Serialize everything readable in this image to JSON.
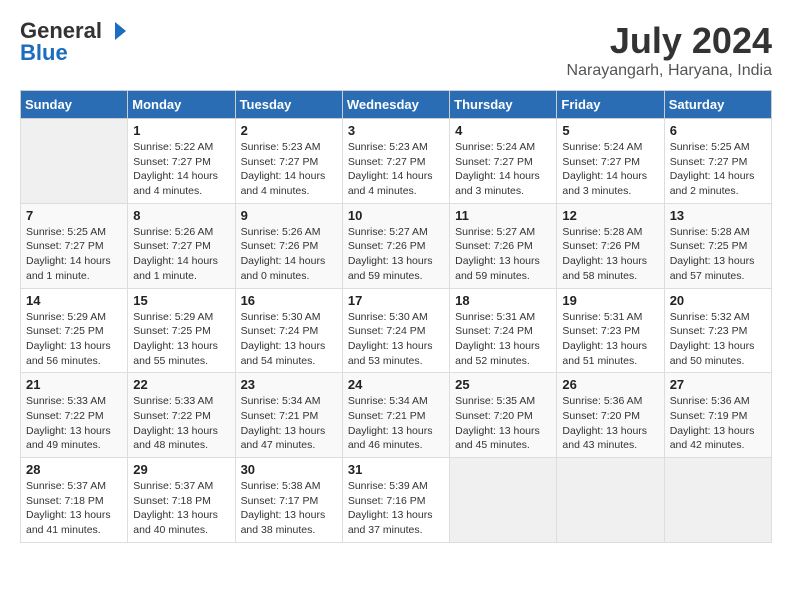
{
  "header": {
    "logo_general": "General",
    "logo_blue": "Blue",
    "month_year": "July 2024",
    "location": "Narayangarh, Haryana, India"
  },
  "calendar": {
    "days_of_week": [
      "Sunday",
      "Monday",
      "Tuesday",
      "Wednesday",
      "Thursday",
      "Friday",
      "Saturday"
    ],
    "weeks": [
      [
        {
          "day": "",
          "sunrise": "",
          "sunset": "",
          "daylight": ""
        },
        {
          "day": "1",
          "sunrise": "Sunrise: 5:22 AM",
          "sunset": "Sunset: 7:27 PM",
          "daylight": "Daylight: 14 hours and 4 minutes."
        },
        {
          "day": "2",
          "sunrise": "Sunrise: 5:23 AM",
          "sunset": "Sunset: 7:27 PM",
          "daylight": "Daylight: 14 hours and 4 minutes."
        },
        {
          "day": "3",
          "sunrise": "Sunrise: 5:23 AM",
          "sunset": "Sunset: 7:27 PM",
          "daylight": "Daylight: 14 hours and 4 minutes."
        },
        {
          "day": "4",
          "sunrise": "Sunrise: 5:24 AM",
          "sunset": "Sunset: 7:27 PM",
          "daylight": "Daylight: 14 hours and 3 minutes."
        },
        {
          "day": "5",
          "sunrise": "Sunrise: 5:24 AM",
          "sunset": "Sunset: 7:27 PM",
          "daylight": "Daylight: 14 hours and 3 minutes."
        },
        {
          "day": "6",
          "sunrise": "Sunrise: 5:25 AM",
          "sunset": "Sunset: 7:27 PM",
          "daylight": "Daylight: 14 hours and 2 minutes."
        }
      ],
      [
        {
          "day": "7",
          "sunrise": "Sunrise: 5:25 AM",
          "sunset": "Sunset: 7:27 PM",
          "daylight": "Daylight: 14 hours and 1 minute."
        },
        {
          "day": "8",
          "sunrise": "Sunrise: 5:26 AM",
          "sunset": "Sunset: 7:27 PM",
          "daylight": "Daylight: 14 hours and 1 minute."
        },
        {
          "day": "9",
          "sunrise": "Sunrise: 5:26 AM",
          "sunset": "Sunset: 7:26 PM",
          "daylight": "Daylight: 14 hours and 0 minutes."
        },
        {
          "day": "10",
          "sunrise": "Sunrise: 5:27 AM",
          "sunset": "Sunset: 7:26 PM",
          "daylight": "Daylight: 13 hours and 59 minutes."
        },
        {
          "day": "11",
          "sunrise": "Sunrise: 5:27 AM",
          "sunset": "Sunset: 7:26 PM",
          "daylight": "Daylight: 13 hours and 59 minutes."
        },
        {
          "day": "12",
          "sunrise": "Sunrise: 5:28 AM",
          "sunset": "Sunset: 7:26 PM",
          "daylight": "Daylight: 13 hours and 58 minutes."
        },
        {
          "day": "13",
          "sunrise": "Sunrise: 5:28 AM",
          "sunset": "Sunset: 7:25 PM",
          "daylight": "Daylight: 13 hours and 57 minutes."
        }
      ],
      [
        {
          "day": "14",
          "sunrise": "Sunrise: 5:29 AM",
          "sunset": "Sunset: 7:25 PM",
          "daylight": "Daylight: 13 hours and 56 minutes."
        },
        {
          "day": "15",
          "sunrise": "Sunrise: 5:29 AM",
          "sunset": "Sunset: 7:25 PM",
          "daylight": "Daylight: 13 hours and 55 minutes."
        },
        {
          "day": "16",
          "sunrise": "Sunrise: 5:30 AM",
          "sunset": "Sunset: 7:24 PM",
          "daylight": "Daylight: 13 hours and 54 minutes."
        },
        {
          "day": "17",
          "sunrise": "Sunrise: 5:30 AM",
          "sunset": "Sunset: 7:24 PM",
          "daylight": "Daylight: 13 hours and 53 minutes."
        },
        {
          "day": "18",
          "sunrise": "Sunrise: 5:31 AM",
          "sunset": "Sunset: 7:24 PM",
          "daylight": "Daylight: 13 hours and 52 minutes."
        },
        {
          "day": "19",
          "sunrise": "Sunrise: 5:31 AM",
          "sunset": "Sunset: 7:23 PM",
          "daylight": "Daylight: 13 hours and 51 minutes."
        },
        {
          "day": "20",
          "sunrise": "Sunrise: 5:32 AM",
          "sunset": "Sunset: 7:23 PM",
          "daylight": "Daylight: 13 hours and 50 minutes."
        }
      ],
      [
        {
          "day": "21",
          "sunrise": "Sunrise: 5:33 AM",
          "sunset": "Sunset: 7:22 PM",
          "daylight": "Daylight: 13 hours and 49 minutes."
        },
        {
          "day": "22",
          "sunrise": "Sunrise: 5:33 AM",
          "sunset": "Sunset: 7:22 PM",
          "daylight": "Daylight: 13 hours and 48 minutes."
        },
        {
          "day": "23",
          "sunrise": "Sunrise: 5:34 AM",
          "sunset": "Sunset: 7:21 PM",
          "daylight": "Daylight: 13 hours and 47 minutes."
        },
        {
          "day": "24",
          "sunrise": "Sunrise: 5:34 AM",
          "sunset": "Sunset: 7:21 PM",
          "daylight": "Daylight: 13 hours and 46 minutes."
        },
        {
          "day": "25",
          "sunrise": "Sunrise: 5:35 AM",
          "sunset": "Sunset: 7:20 PM",
          "daylight": "Daylight: 13 hours and 45 minutes."
        },
        {
          "day": "26",
          "sunrise": "Sunrise: 5:36 AM",
          "sunset": "Sunset: 7:20 PM",
          "daylight": "Daylight: 13 hours and 43 minutes."
        },
        {
          "day": "27",
          "sunrise": "Sunrise: 5:36 AM",
          "sunset": "Sunset: 7:19 PM",
          "daylight": "Daylight: 13 hours and 42 minutes."
        }
      ],
      [
        {
          "day": "28",
          "sunrise": "Sunrise: 5:37 AM",
          "sunset": "Sunset: 7:18 PM",
          "daylight": "Daylight: 13 hours and 41 minutes."
        },
        {
          "day": "29",
          "sunrise": "Sunrise: 5:37 AM",
          "sunset": "Sunset: 7:18 PM",
          "daylight": "Daylight: 13 hours and 40 minutes."
        },
        {
          "day": "30",
          "sunrise": "Sunrise: 5:38 AM",
          "sunset": "Sunset: 7:17 PM",
          "daylight": "Daylight: 13 hours and 38 minutes."
        },
        {
          "day": "31",
          "sunrise": "Sunrise: 5:39 AM",
          "sunset": "Sunset: 7:16 PM",
          "daylight": "Daylight: 13 hours and 37 minutes."
        },
        {
          "day": "",
          "sunrise": "",
          "sunset": "",
          "daylight": ""
        },
        {
          "day": "",
          "sunrise": "",
          "sunset": "",
          "daylight": ""
        },
        {
          "day": "",
          "sunrise": "",
          "sunset": "",
          "daylight": ""
        }
      ]
    ]
  }
}
